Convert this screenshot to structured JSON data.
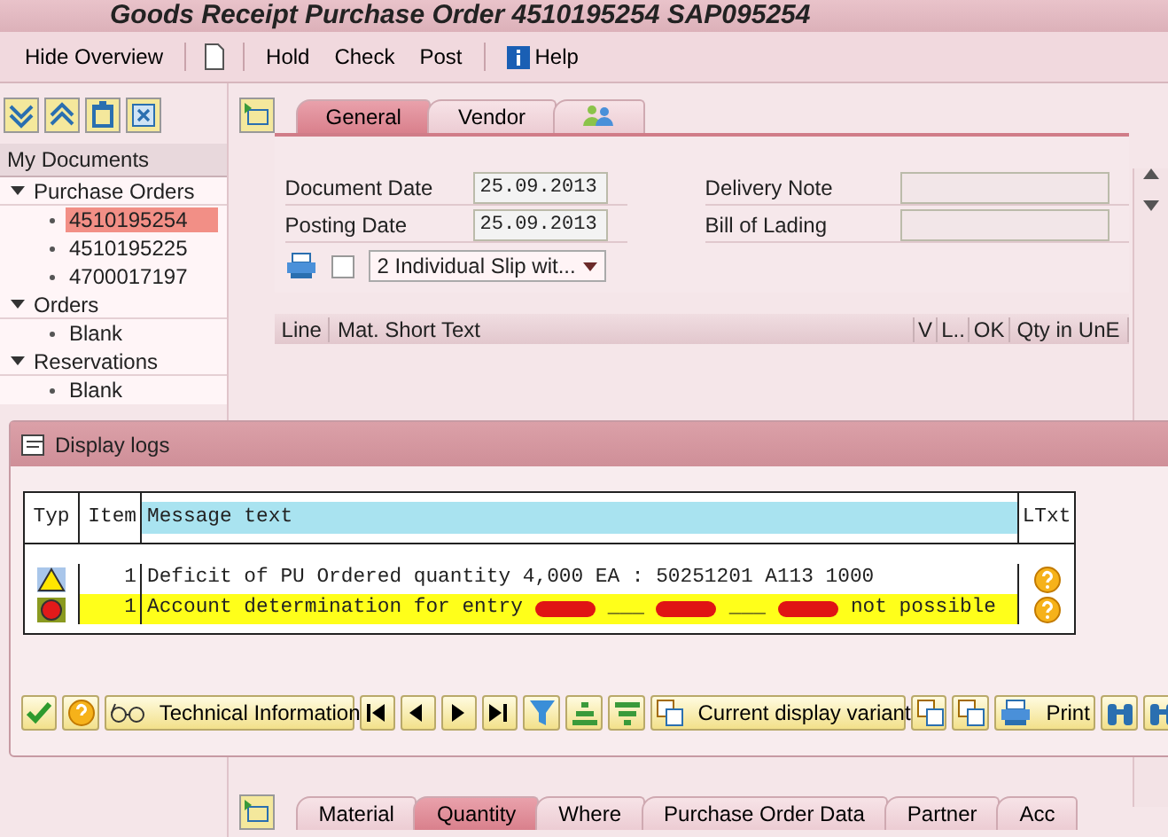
{
  "window": {
    "title": "Goods Receipt Purchase Order 4510195254   SAP095254"
  },
  "toolbar": [
    {
      "kind": "text",
      "label": "Hide Overview"
    },
    {
      "kind": "separator"
    },
    {
      "kind": "page"
    },
    {
      "kind": "separator"
    },
    {
      "kind": "text",
      "label": "Hold"
    },
    {
      "kind": "text",
      "label": "Check"
    },
    {
      "kind": "text",
      "label": "Post"
    },
    {
      "kind": "separator"
    },
    {
      "kind": "info",
      "label": "Help"
    }
  ],
  "sidebar": {
    "header": "My Documents",
    "tree": [
      {
        "label": "Purchase Orders",
        "expanded": true,
        "children": [
          {
            "label": "4510195254",
            "selected": true
          },
          {
            "label": "4510195225",
            "selected": false
          },
          {
            "label": "4700017197",
            "selected": false
          }
        ]
      },
      {
        "label": "Orders",
        "expanded": true,
        "children": [
          {
            "label": "Blank",
            "selected": false
          }
        ]
      },
      {
        "label": "Reservations",
        "expanded": true,
        "children": [
          {
            "label": "Blank",
            "selected": false
          }
        ]
      }
    ]
  },
  "header_tabs": [
    {
      "kind": "text",
      "label": "General",
      "selected": true
    },
    {
      "kind": "text",
      "label": "Vendor",
      "selected": false
    },
    {
      "kind": "people",
      "selected": false
    }
  ],
  "form": {
    "document_date": {
      "label": "Document Date",
      "value": "25.09.2013"
    },
    "posting_date": {
      "label": "Posting Date",
      "value": "25.09.2013"
    },
    "delivery_note": {
      "label": "Delivery Note"
    },
    "bill_of_lading": {
      "label": "Bill of Lading"
    },
    "print_checked": false,
    "slip": "2 Individual Slip wit..."
  },
  "items_table": {
    "columns": [
      "Line",
      "Mat. Short Text",
      "V",
      "L..",
      "OK",
      "Qty in UnE"
    ]
  },
  "dialog": {
    "title": "Display logs",
    "columns": [
      "Typ",
      "Item",
      "Message text",
      "LTxt"
    ],
    "rows": [
      {
        "kind": "warning",
        "highlighted": false,
        "item": "1",
        "parts": [
          {
            "kind": "text",
            "text": "Deficit of PU Ordered quantity 4,000 EA : 50251201 A113 1000"
          }
        ]
      },
      {
        "kind": "error",
        "highlighted": true,
        "item": "1",
        "parts": [
          {
            "kind": "text",
            "text": "Account determination for entry"
          },
          {
            "kind": "redacted"
          },
          {
            "kind": "text",
            "text": "___"
          },
          {
            "kind": "redacted"
          },
          {
            "kind": "text",
            "text": "___"
          },
          {
            "kind": "redacted"
          },
          {
            "kind": "text",
            "text": "not possible"
          }
        ]
      }
    ],
    "toolbar": [
      {
        "kind": "check"
      },
      {
        "kind": "help"
      },
      {
        "kind": "glasses",
        "label": "Technical Information"
      },
      {
        "kind": "first"
      },
      {
        "kind": "prev"
      },
      {
        "kind": "next"
      },
      {
        "kind": "last"
      },
      {
        "kind": "filter"
      },
      {
        "kind": "sort-up"
      },
      {
        "kind": "sort-down"
      },
      {
        "kind": "layout",
        "label": "Current display variant"
      },
      {
        "kind": "layout"
      },
      {
        "kind": "layout"
      },
      {
        "kind": "printer",
        "label": "Print"
      },
      {
        "kind": "binoculars"
      },
      {
        "kind": "binoculars"
      }
    ]
  },
  "item_tabs": [
    {
      "label": "Material",
      "selected": false
    },
    {
      "label": "Quantity",
      "selected": true
    },
    {
      "label": "Where",
      "selected": false
    },
    {
      "label": "Purchase Order Data",
      "selected": false
    },
    {
      "label": "Partner",
      "selected": false
    },
    {
      "label": "Acc",
      "selected": false
    }
  ]
}
